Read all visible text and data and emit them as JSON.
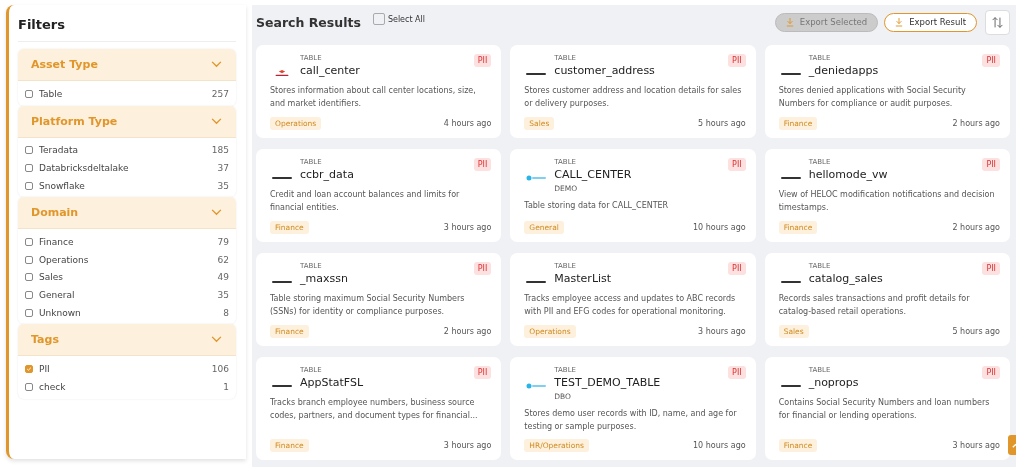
{
  "filters": {
    "title": "Filters",
    "groups": [
      {
        "title": "Asset Type",
        "expanded": true,
        "items": [
          {
            "label": "Table",
            "count": "257",
            "checked": false
          }
        ]
      },
      {
        "title": "Platform Type",
        "expanded": true,
        "items": [
          {
            "label": "Teradata",
            "count": "185",
            "checked": false
          },
          {
            "label": "Databricksdeltalake",
            "count": "37",
            "checked": false
          },
          {
            "label": "Snowflake",
            "count": "35",
            "checked": false
          }
        ]
      },
      {
        "title": "Domain",
        "expanded": true,
        "items": [
          {
            "label": "Finance",
            "count": "79",
            "checked": false
          },
          {
            "label": "Operations",
            "count": "62",
            "checked": false
          },
          {
            "label": "Sales",
            "count": "49",
            "checked": false
          },
          {
            "label": "General",
            "count": "35",
            "checked": false
          },
          {
            "label": "Unknown",
            "count": "8",
            "checked": false
          }
        ]
      },
      {
        "title": "Tags",
        "expanded": true,
        "items": [
          {
            "label": "PII",
            "count": "106",
            "checked": true
          },
          {
            "label": "check",
            "count": "1",
            "checked": false
          }
        ]
      }
    ]
  },
  "results": {
    "title": "Search Results",
    "select_all": {
      "label": "Select All",
      "checked": false
    },
    "buttons": [
      {
        "label": "Export Selected",
        "disabled": true
      },
      {
        "label": "Export Result",
        "disabled": false
      }
    ],
    "cards": [
      {
        "kind": "databricks",
        "type": "TABLE",
        "name": "call_center",
        "badge": "PII",
        "description": "Stores information about call center locations, size, and market identifiers.",
        "tag": "Operations",
        "time": "4 hours ago"
      },
      {
        "kind": "teradata",
        "type": "TABLE",
        "name": "customer_address",
        "badge": "PII",
        "description": "Stores customer address and location details for sales or delivery purposes.",
        "tag": "Sales",
        "time": "5 hours ago"
      },
      {
        "kind": "teradata",
        "type": "TABLE",
        "name": "_deniedapps",
        "badge": "PII",
        "description": "Stores denied applications with Social Security Numbers for compliance or audit purposes.",
        "tag": "Finance",
        "time": "2 hours ago"
      },
      {
        "kind": "teradata",
        "type": "TABLE",
        "name": "ccbr_data",
        "badge": "PII",
        "description": "Credit and loan account balances and limits for financial entities.",
        "tag": "Finance",
        "time": "3 hours ago"
      },
      {
        "kind": "snowflake",
        "type": "TABLE",
        "name": "CALL_CENTER",
        "schema": "DEMO",
        "badge": "PII",
        "description": "Table storing data for CALL_CENTER",
        "tag": "General",
        "time": "10 hours ago"
      },
      {
        "kind": "teradata",
        "type": "TABLE",
        "name": "hellomode_vw",
        "badge": "PII",
        "description": "View of HELOC modification notifications and decision timestamps.",
        "tag": "Finance",
        "time": "2 hours ago"
      },
      {
        "kind": "teradata",
        "type": "TABLE",
        "name": "_maxssn",
        "badge": "PII",
        "description": "Table storing maximum Social Security Numbers (SSNs) for identity or compliance purposes.",
        "tag": "Finance",
        "time": "2 hours ago"
      },
      {
        "kind": "teradata",
        "type": "TABLE",
        "name": "MasterList",
        "badge": "PII",
        "description": "Tracks employee access and updates to ABC records with PII and EFG codes for operational monitoring.",
        "tag": "Operations",
        "time": "3 hours ago"
      },
      {
        "kind": "teradata",
        "type": "TABLE",
        "name": "catalog_sales",
        "badge": "PII",
        "description": "Records sales transactions and profit details for catalog-based retail operations.",
        "tag": "Sales",
        "time": "5 hours ago"
      },
      {
        "kind": "teradata",
        "type": "TABLE",
        "name": "AppStatFSL",
        "badge": "PII",
        "description": "Tracks branch employee numbers, business source codes, partners, and document types for financial...",
        "tag": "Finance",
        "time": "3 hours ago"
      },
      {
        "kind": "snowflake",
        "type": "TABLE",
        "name": "TEST_DEMO_TABLE",
        "schema": "DBO",
        "badge": "PII",
        "description": "Stores demo user records with ID, name, and age for testing or sample purposes.",
        "tag": "HR/Operations",
        "time": "10 hours ago"
      },
      {
        "kind": "teradata",
        "type": "TABLE",
        "name": "_noprops",
        "badge": "PII",
        "description": "Contains Social Security Numbers and loan numbers for financial or lending operations.",
        "tag": "Finance",
        "time": "3 hours ago"
      }
    ]
  }
}
